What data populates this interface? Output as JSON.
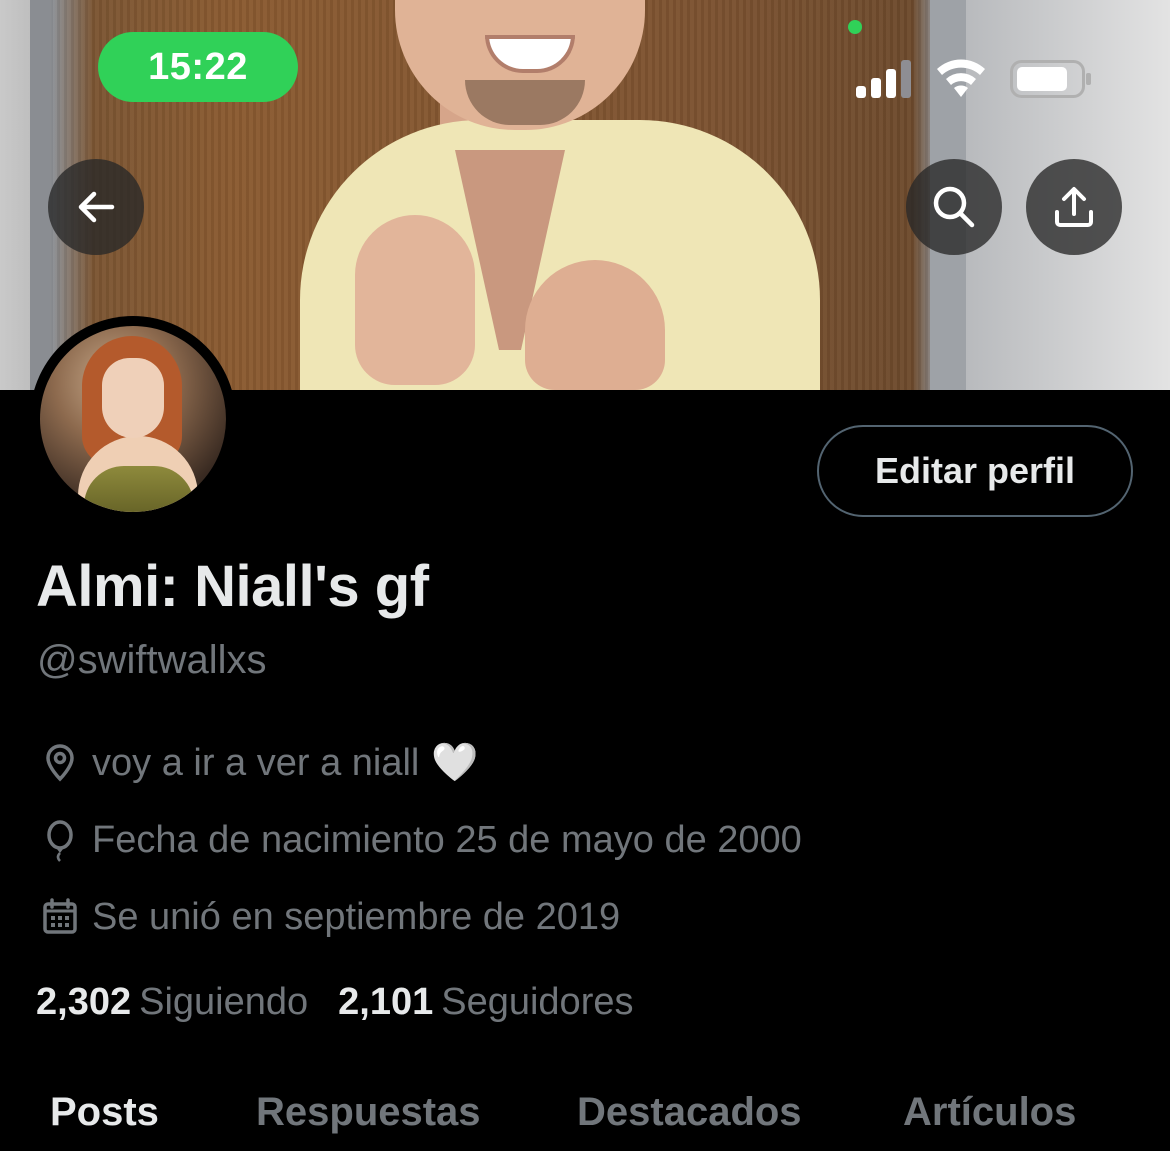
{
  "status_bar": {
    "time": "15:22",
    "accent_color": "#30d158"
  },
  "header": {
    "back_icon": "arrow-left-icon",
    "search_icon": "search-icon",
    "share_icon": "share-upload-icon"
  },
  "profile": {
    "edit_button_label": "Editar perfil",
    "display_name": "Almi: Niall's gf",
    "handle": "@swiftwallxs",
    "location": "voy a ir a ver a niall",
    "location_emoji": "🤍",
    "birthday": "Fecha de nacimiento 25 de mayo de 2000",
    "joined": "Se unió en septiembre de 2019",
    "following_count": "2,302",
    "following_label": "Siguiendo",
    "followers_count": "2,101",
    "followers_label": "Seguidores"
  },
  "tabs": [
    {
      "label": "Posts",
      "active": true
    },
    {
      "label": "Respuestas",
      "active": false
    },
    {
      "label": "Destacados",
      "active": false
    },
    {
      "label": "Artículos",
      "active": false
    }
  ],
  "colors": {
    "background": "#000000",
    "primary_text": "#e7e9ea",
    "secondary_text": "#71767b",
    "border": "#536471"
  }
}
